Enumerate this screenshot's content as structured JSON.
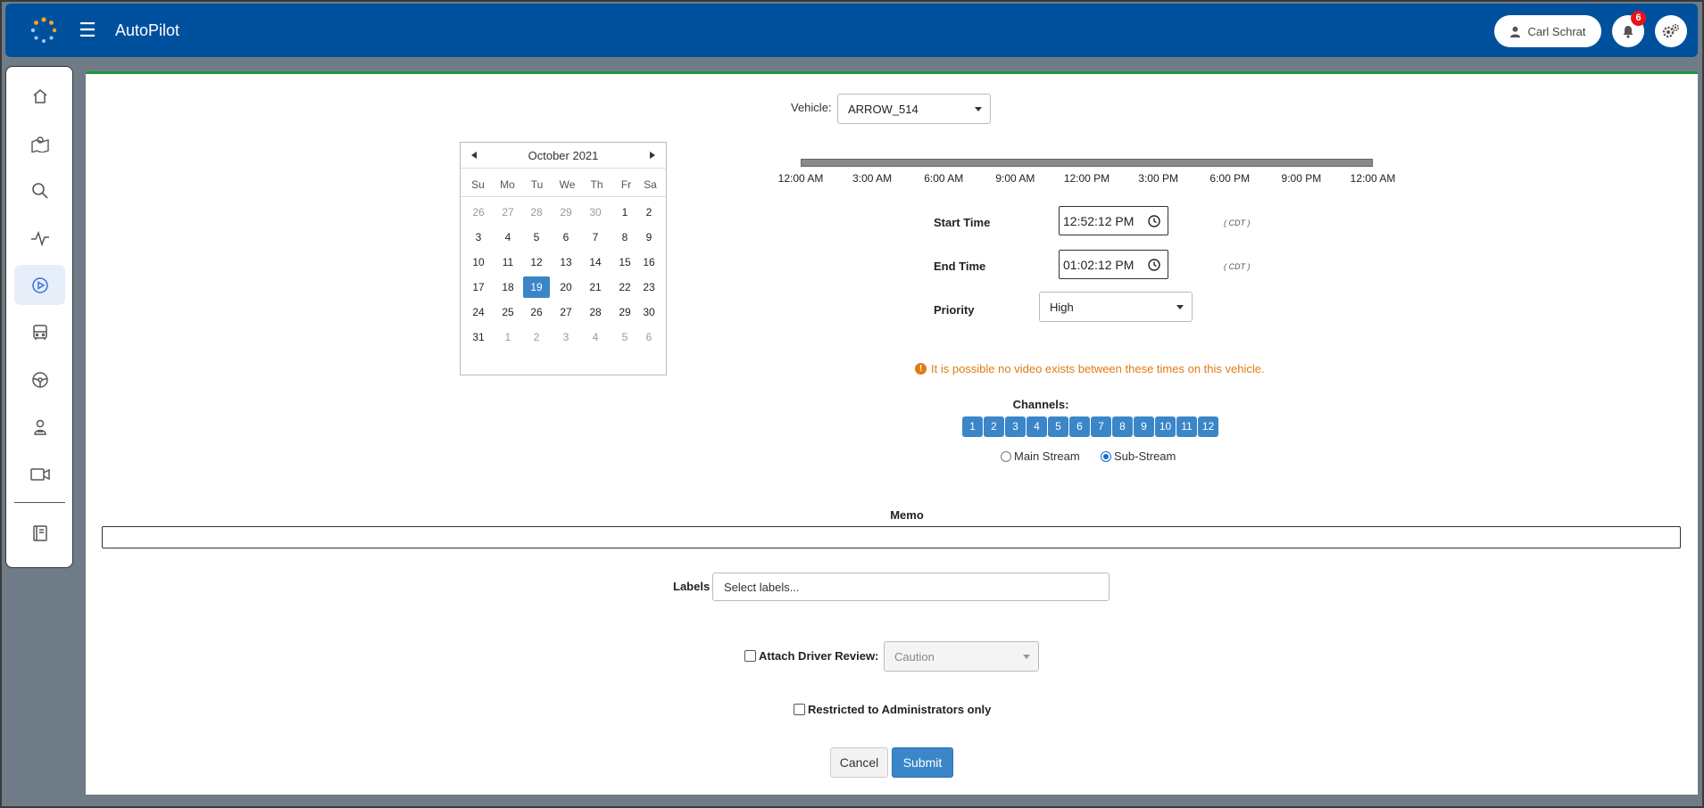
{
  "header": {
    "app_title": "AutoPilot",
    "user_name": "Carl Schrat",
    "notification_count": "6"
  },
  "sidebar": {
    "items": [
      {
        "icon": "home-icon"
      },
      {
        "icon": "map-icon"
      },
      {
        "icon": "search-icon"
      },
      {
        "icon": "activity-icon"
      },
      {
        "icon": "play-circle-icon",
        "active": true
      },
      {
        "icon": "bus-icon"
      },
      {
        "icon": "steering-wheel-icon"
      },
      {
        "icon": "driver-icon"
      },
      {
        "icon": "video-camera-icon"
      },
      {
        "icon": "book-icon"
      }
    ]
  },
  "form": {
    "vehicle_label": "Vehicle:",
    "vehicle_value": "ARROW_514",
    "calendar": {
      "month_title": "October 2021",
      "weekdays": [
        "Su",
        "Mo",
        "Tu",
        "We",
        "Th",
        "Fr",
        "Sa"
      ],
      "weeks": [
        [
          "26",
          "27",
          "28",
          "29",
          "30",
          "1",
          "2"
        ],
        [
          "3",
          "4",
          "5",
          "6",
          "7",
          "8",
          "9"
        ],
        [
          "10",
          "11",
          "12",
          "13",
          "14",
          "15",
          "16"
        ],
        [
          "17",
          "18",
          "19",
          "20",
          "21",
          "22",
          "23"
        ],
        [
          "24",
          "25",
          "26",
          "27",
          "28",
          "29",
          "30"
        ],
        [
          "31",
          "1",
          "2",
          "3",
          "4",
          "5",
          "6"
        ]
      ],
      "selected_day": "19"
    },
    "timeline_ticks": [
      "12:00 AM",
      "3:00 AM",
      "6:00 AM",
      "9:00 AM",
      "12:00 PM",
      "3:00 PM",
      "6:00 PM",
      "9:00 PM",
      "12:00 AM"
    ],
    "start_time_label": "Start Time",
    "start_time_value": "12:52:12 PM",
    "end_time_label": "End Time",
    "end_time_value": "01:02:12 PM",
    "timezone": "( CDT )",
    "priority_label": "Priority",
    "priority_value": "High",
    "warning_text": "It is possible no video exists between these times on this vehicle.",
    "channels_label": "Channels:",
    "channels": [
      "1",
      "2",
      "3",
      "4",
      "5",
      "6",
      "7",
      "8",
      "9",
      "10",
      "11",
      "12"
    ],
    "stream_main_label": "Main Stream",
    "stream_sub_label": "Sub-Stream",
    "stream_selected": "Sub-Stream",
    "memo_label": "Memo",
    "memo_value": "",
    "labels_label": "Labels",
    "labels_placeholder": "Select labels...",
    "attach_review_label": "Attach Driver Review:",
    "attach_review_value": "Caution",
    "restricted_label": "Restricted to Administrators only",
    "cancel_label": "Cancel",
    "submit_label": "Submit"
  },
  "colors": {
    "header_bg": "#00519d",
    "accent": "#3a86c8",
    "warning": "#e07b12",
    "top_border": "#1a9a3a",
    "badge": "#e8141c"
  }
}
